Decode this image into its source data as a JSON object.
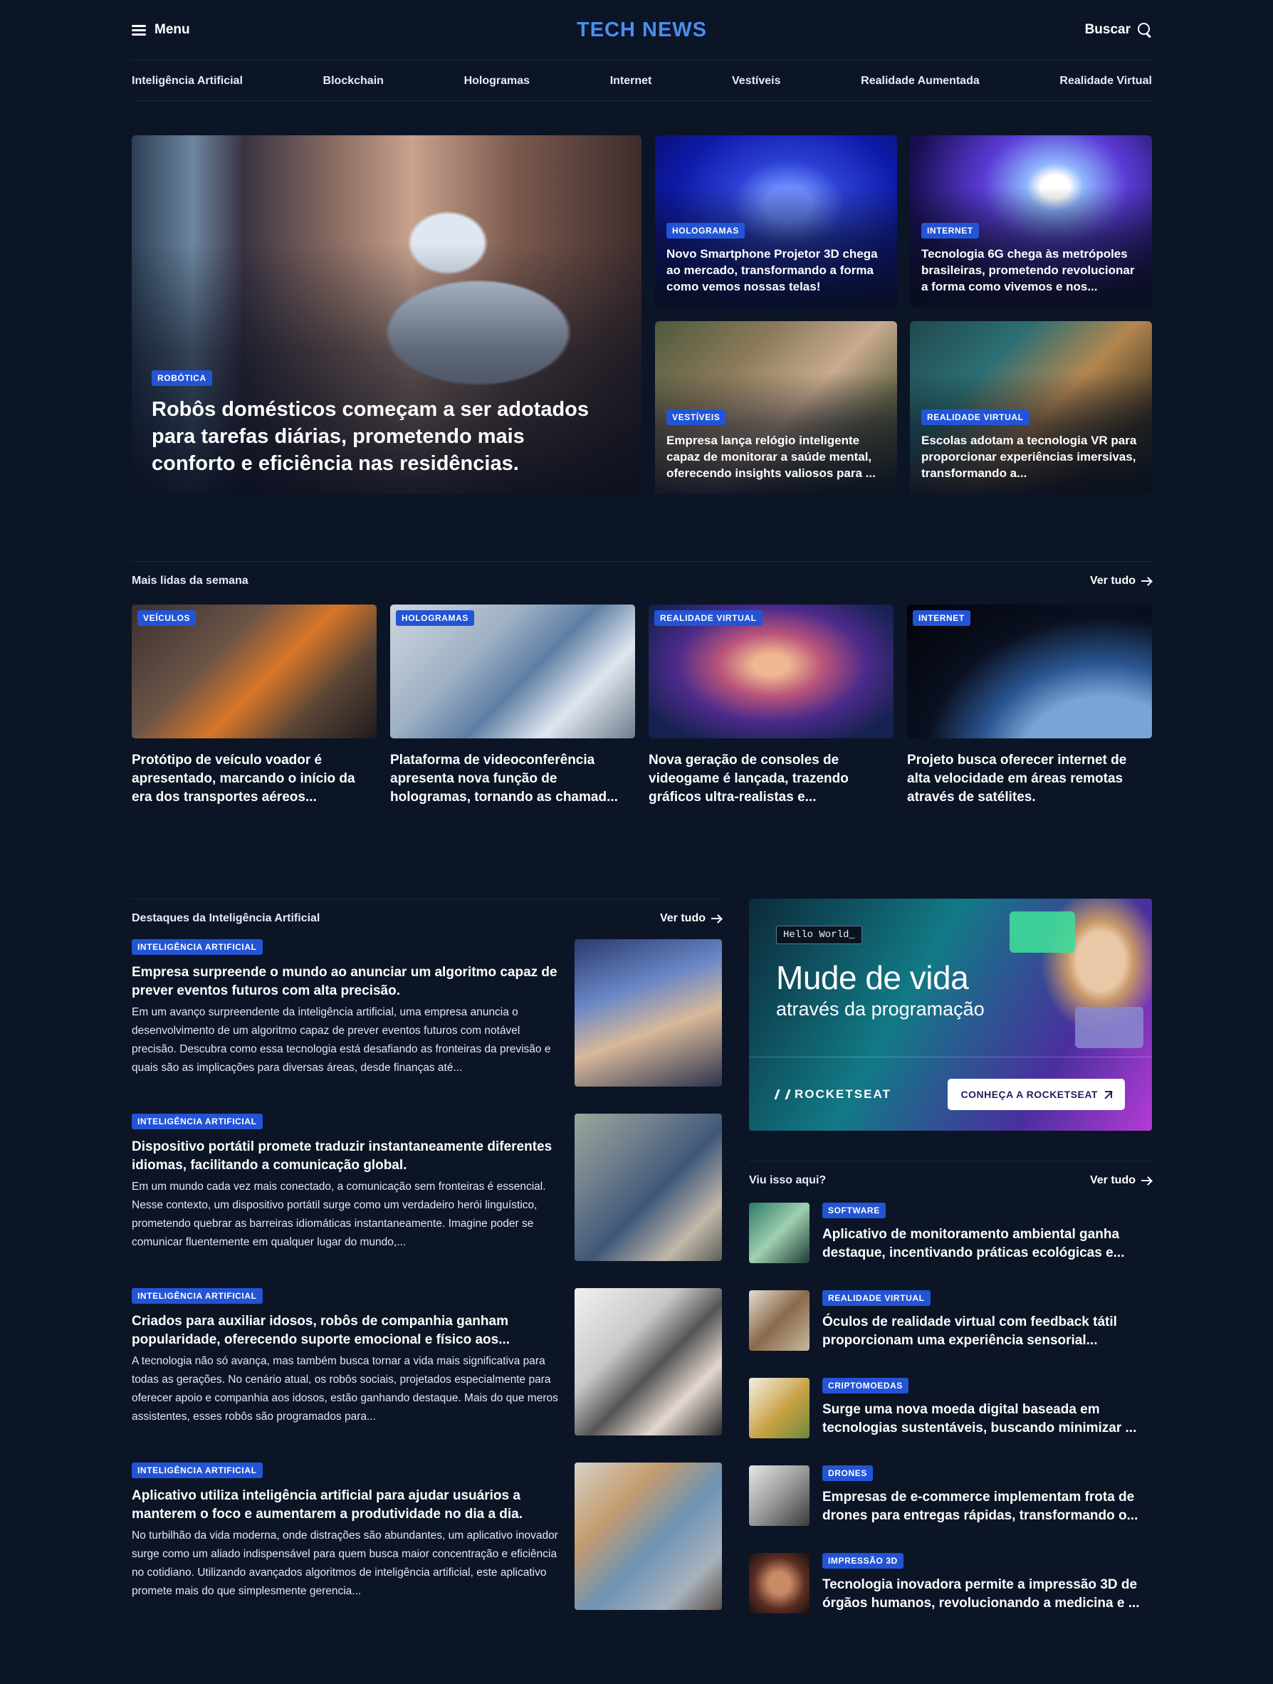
{
  "header": {
    "menu_label": "Menu",
    "logo": "TECH NEWS",
    "search_label": "Buscar"
  },
  "nav": [
    "Inteligência Artificial",
    "Blockchain",
    "Hologramas",
    "Internet",
    "Vestíveis",
    "Realidade Aumentada",
    "Realidade Virtual"
  ],
  "hero": {
    "main": {
      "badge": "Robótica",
      "title": "Robôs domésticos começam a ser adotados para tarefas diárias, prometendo mais conforto e eficiência nas residências."
    },
    "side": [
      {
        "badge": "Hologramas",
        "title": "Novo Smartphone Projetor 3D chega ao mercado, transformando a forma como vemos nossas telas!"
      },
      {
        "badge": "Internet",
        "title": "Tecnologia 6G chega às metrópoles brasileiras, prometendo revolucionar a forma como vivemos e nos..."
      },
      {
        "badge": "Vestíveis",
        "title": "Empresa lança relógio inteligente capaz de monitorar a saúde mental, oferecendo insights valiosos para ..."
      },
      {
        "badge": "Realidade Virtual",
        "title": "Escolas adotam a tecnologia VR para proporcionar experiências imersivas, transformando a..."
      }
    ]
  },
  "most_read": {
    "title": "Mais lidas da semana",
    "see_all": "Ver tudo",
    "items": [
      {
        "badge": "Veículos",
        "title": "Protótipo de veículo voador é apresentado, marcando o início da era dos transportes aéreos..."
      },
      {
        "badge": "Hologramas",
        "title": "Plataforma de videoconferência apresenta nova função de hologramas, tornando as chamad..."
      },
      {
        "badge": "Realidade Virtual",
        "title": "Nova geração de consoles de videogame é lançada, trazendo gráficos ultra-realistas e..."
      },
      {
        "badge": "Internet",
        "title": "Projeto busca oferecer internet de alta velocidade em áreas remotas através de satélites."
      }
    ]
  },
  "ai": {
    "title": "Destaques da Inteligência Artificial",
    "see_all": "Ver tudo",
    "items": [
      {
        "badge": "Inteligência Artificial",
        "title": "Empresa surpreende o mundo ao anunciar um algoritmo capaz de prever eventos futuros com alta precisão.",
        "excerpt": "Em um avanço surpreendente da inteligência artificial, uma empresa anuncia o desenvolvimento de um algoritmo capaz de prever eventos futuros com notável precisão. Descubra como essa tecnologia está desafiando as fronteiras da previsão e quais são as implicações para diversas áreas, desde finanças até..."
      },
      {
        "badge": "Inteligência Artificial",
        "title": "Dispositivo portátil promete traduzir instantaneamente diferentes idiomas, facilitando a comunicação global.",
        "excerpt": "Em um mundo cada vez mais conectado, a comunicação sem fronteiras é essencial. Nesse contexto, um dispositivo portátil surge como um verdadeiro herói linguístico, prometendo quebrar as barreiras idiomáticas instantaneamente. Imagine poder se comunicar fluentemente em qualquer lugar do mundo,..."
      },
      {
        "badge": "Inteligência Artificial",
        "title": "Criados para auxiliar idosos, robôs de companhia ganham popularidade, oferecendo suporte emocional e físico aos...",
        "excerpt": "A tecnologia não só avança, mas também busca tornar a vida mais significativa para todas as gerações. No cenário atual, os robôs sociais, projetados especialmente para oferecer apoio e companhia aos idosos, estão ganhando destaque. Mais do que meros assistentes, esses robôs são programados para..."
      },
      {
        "badge": "Inteligência Artificial",
        "title": "Aplicativo utiliza inteligência artificial para ajudar usuários a manterem o foco e aumentarem a produtividade no dia a dia.",
        "excerpt": "No turbilhão da vida moderna, onde distrações são abundantes, um aplicativo inovador surge como um aliado indispensável para quem busca maior concentração e eficiência no cotidiano. Utilizando avançados algoritmos de inteligência artificial, este aplicativo promete mais do que simplesmente gerencia..."
      }
    ]
  },
  "ad": {
    "hello": "Hello World_",
    "headline": "Mude de vida",
    "subheadline": "através da programação",
    "brand": "ROCKETSEAT",
    "cta": "CONHEÇA A ROCKETSEAT"
  },
  "seen": {
    "title": "Viu isso aqui?",
    "see_all": "Ver tudo",
    "items": [
      {
        "badge": "Software",
        "title": "Aplicativo de monitoramento ambiental ganha destaque, incentivando práticas ecológicas e..."
      },
      {
        "badge": "Realidade Virtual",
        "title": "Óculos de realidade virtual com feedback tátil proporcionam uma experiência sensorial..."
      },
      {
        "badge": "Criptomoedas",
        "title": "Surge uma nova moeda digital baseada em tecnologias sustentáveis, buscando minimizar ..."
      },
      {
        "badge": "Drones",
        "title": "Empresas de e-commerce implementam frota de drones para entregas rápidas, transformando o..."
      },
      {
        "badge": "Impressão 3D",
        "title": "Tecnologia inovadora permite a impressão 3D de órgãos humanos, revolucionando a medicina e ..."
      }
    ]
  }
}
